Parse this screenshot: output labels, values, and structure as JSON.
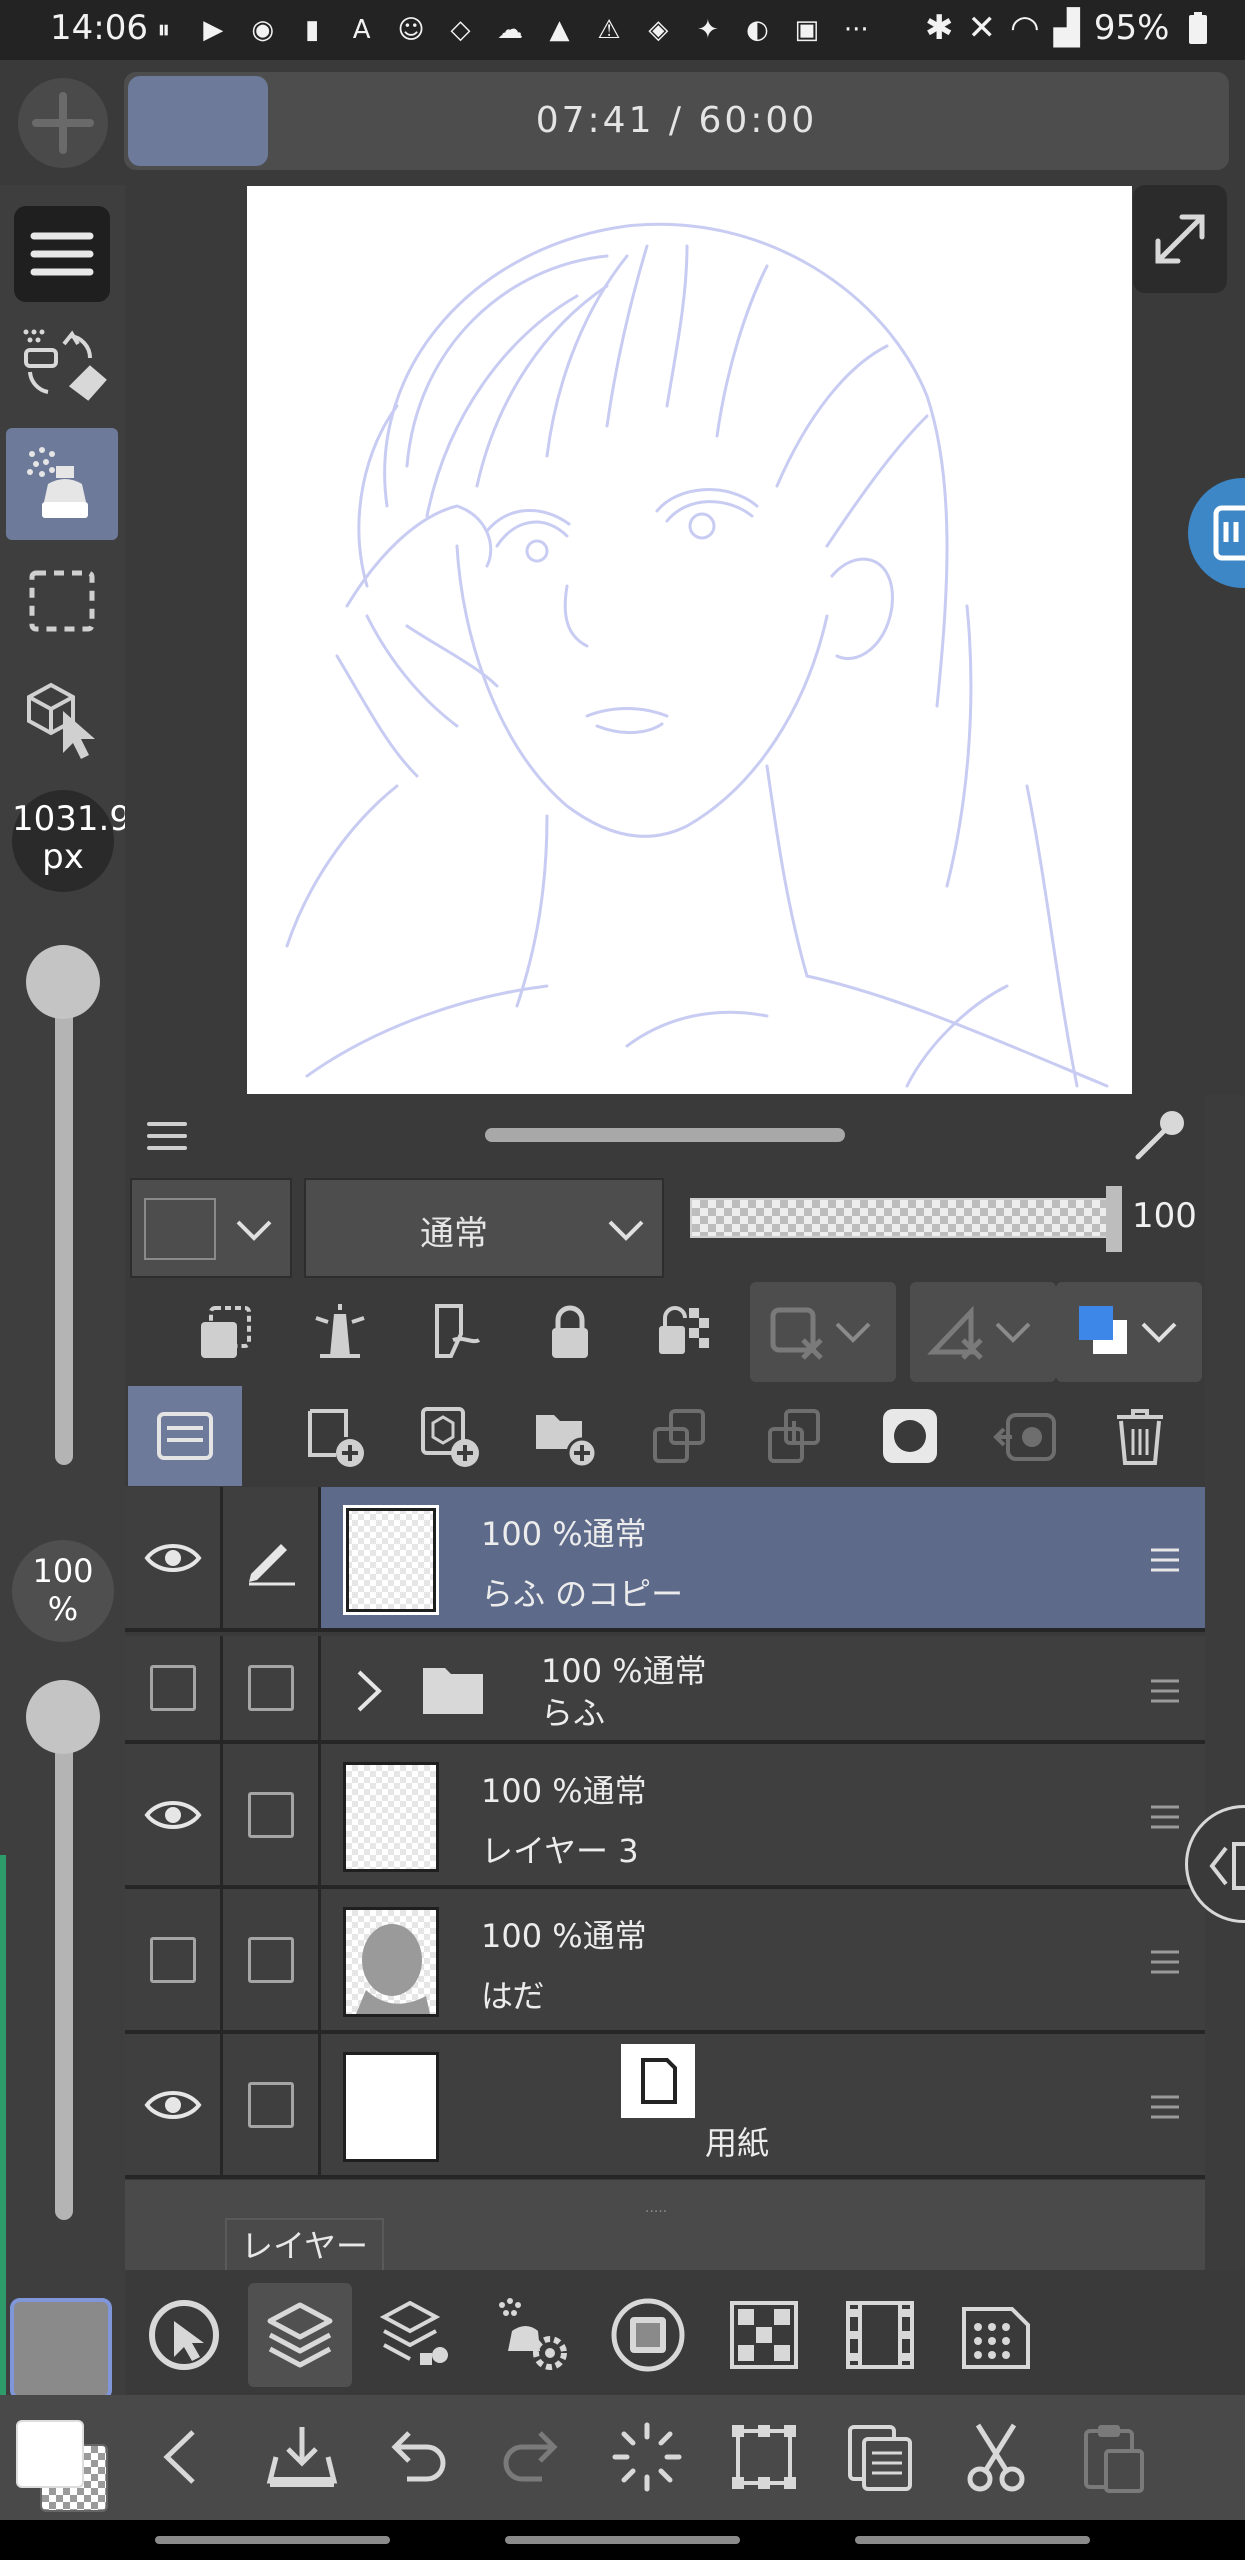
{
  "status_bar": {
    "time": "14:06",
    "battery": "95%",
    "notification_icons": [
      "pause-icon",
      "youtube-icon",
      "line-icon",
      "app-icon",
      "a-icon",
      "face-app-icon",
      "kurashiru-icon",
      "cloud-icon",
      "mountain-icon",
      "warning-icon",
      "no-sim-icon",
      "twitter-icon",
      "game-icon",
      "news-icon",
      "more-icon"
    ],
    "more": "···"
  },
  "timer": {
    "text": "07:41 / 60:00",
    "progress_fraction": 0.128
  },
  "left_toolbar": {
    "brush_size": "1031.9",
    "brush_size_unit": "px",
    "brush_slider_level": 1.0,
    "opacity": "100",
    "opacity_unit": "%",
    "opacity_slider_level": 1.0
  },
  "layer_properties": {
    "blend_mode": "通常",
    "opacity_value": "100",
    "layer_color_swatch": "#4d4d4d",
    "palette_main_color": "#3d87e8",
    "palette_sub_color": "#ffffff"
  },
  "layers": [
    {
      "visible": true,
      "editing": true,
      "mode": "100 %通常",
      "name": "らふ のコピー",
      "thumb": "checker",
      "selected": true
    },
    {
      "visible": false,
      "editing": false,
      "mode": "100 %通常",
      "name": "らふ",
      "thumb": "folder",
      "selected": false
    },
    {
      "visible": true,
      "editing": false,
      "mode": "100 %通常",
      "name": "レイヤー 3",
      "thumb": "checker",
      "selected": false
    },
    {
      "visible": false,
      "editing": false,
      "mode": "100 %通常",
      "name": "はだ",
      "thumb": "skin",
      "selected": false
    },
    {
      "visible": true,
      "editing": false,
      "mode": "",
      "name": "用紙",
      "thumb": "white",
      "selected": false
    }
  ],
  "panel": {
    "tooltip": "レイヤー",
    "dots": "....."
  },
  "colors": {
    "accent": "#6d7a9a",
    "selected_layer": "#5e6a8a",
    "sketch_line": "#c8ccf2",
    "side_tab": "#3d87c7",
    "left_accent": "#2e9b6a"
  }
}
